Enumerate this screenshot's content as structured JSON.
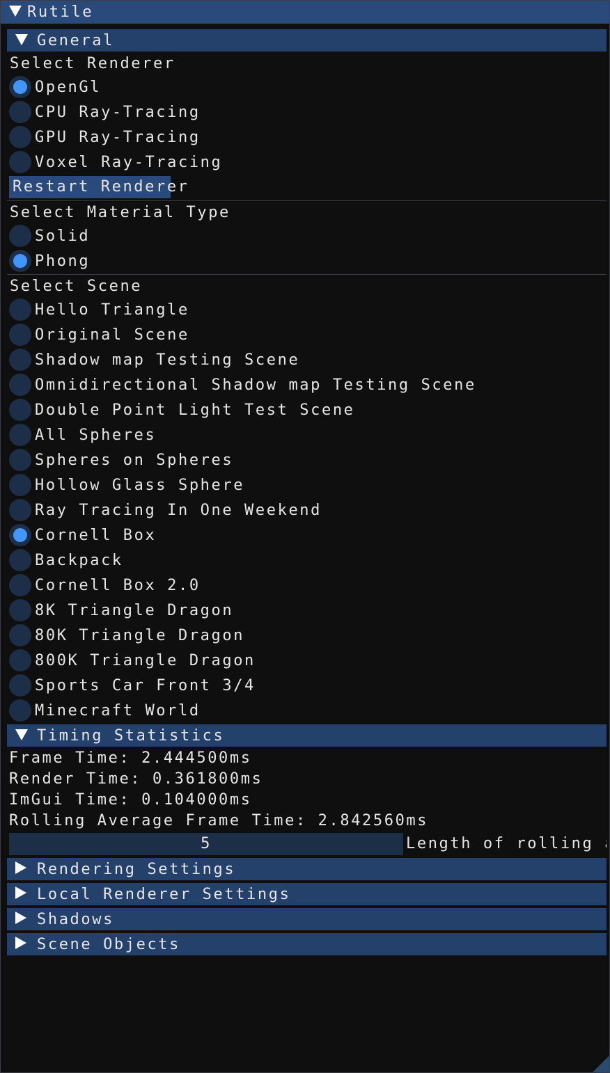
{
  "window": {
    "title": "Rutile"
  },
  "general": {
    "header": "General",
    "renderer": {
      "label": "Select Renderer",
      "options": [
        "OpenGl",
        "CPU Ray-Tracing",
        "GPU Ray-Tracing",
        "Voxel Ray-Tracing"
      ],
      "selected": "OpenGl"
    },
    "restart_button": "Restart Renderer",
    "material": {
      "label": "Select Material Type",
      "options": [
        "Solid",
        "Phong"
      ],
      "selected": "Phong"
    },
    "scene": {
      "label": "Select Scene",
      "options": [
        "Hello Triangle",
        "Original Scene",
        "Shadow map Testing Scene",
        "Omnidirectional Shadow map Testing Scene",
        "Double Point Light Test Scene",
        "All Spheres",
        "Spheres on Spheres",
        "Hollow Glass Sphere",
        "Ray Tracing In One Weekend",
        "Cornell Box",
        "Backpack",
        "Cornell Box 2.0",
        "8K Triangle Dragon",
        "80K Triangle Dragon",
        "800K Triangle Dragon",
        "Sports Car Front 3/4",
        "Minecraft World"
      ],
      "selected": "Cornell Box"
    }
  },
  "timing": {
    "header": "Timing Statistics",
    "frame_time": "Frame Time: 2.444500ms",
    "render_time": "Render Time: 0.361800ms",
    "imgui_time": "ImGui Time: 0.104000ms",
    "rolling_avg": "Rolling Average Frame Time: 2.842560ms",
    "slider_value": "5",
    "slider_label": "Length of rolling ave"
  },
  "sections": {
    "rendering_settings": "Rendering Settings",
    "local_renderer_settings": "Local Renderer Settings",
    "shadows": "Shadows",
    "scene_objects": "Scene Objects"
  },
  "colors": {
    "title_bg": "#294a7a",
    "header_bg": "#23416a",
    "radio_bg": "#1d2e48",
    "radio_check": "#4296fa",
    "window_bg": "#0f0f0f"
  }
}
